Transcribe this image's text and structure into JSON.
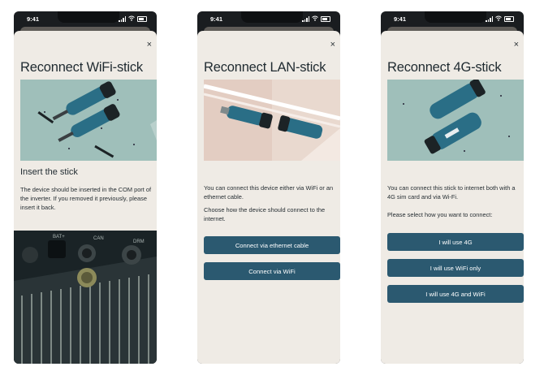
{
  "status_time": "9:41",
  "screens": [
    {
      "title": "Reconnect WiFi-stick",
      "close_glyph": "×",
      "subheading": "Insert the stick",
      "paragraphs": [
        "The device should be inserted in the COM port of the inverter. If you removed it previously, please insert it back."
      ],
      "photo_labels": [
        "BAT+",
        "CAN",
        "DRM"
      ]
    },
    {
      "title": "Reconnect LAN-stick",
      "close_glyph": "×",
      "paragraphs": [
        "You can connect this device either via WiFi or an ethernet cable.",
        "Choose how the device should connect to the internet."
      ],
      "buttons": [
        "Connect via ethernet cable",
        "Connect via WiFi"
      ]
    },
    {
      "title": "Reconnect 4G-stick",
      "close_glyph": "×",
      "paragraphs": [
        "You can connect this stick to internet both with a 4G sim card and via Wi-Fi.",
        "Please select how you want to connect:"
      ],
      "buttons": [
        "I will use 4G",
        "I will use WiFi only",
        "I will use 4G and WiFi"
      ]
    }
  ],
  "colors": {
    "button": "#2b5970",
    "card": "#efebe5",
    "hero_teal": "#9fbfba",
    "stick": "#2a6e86"
  }
}
